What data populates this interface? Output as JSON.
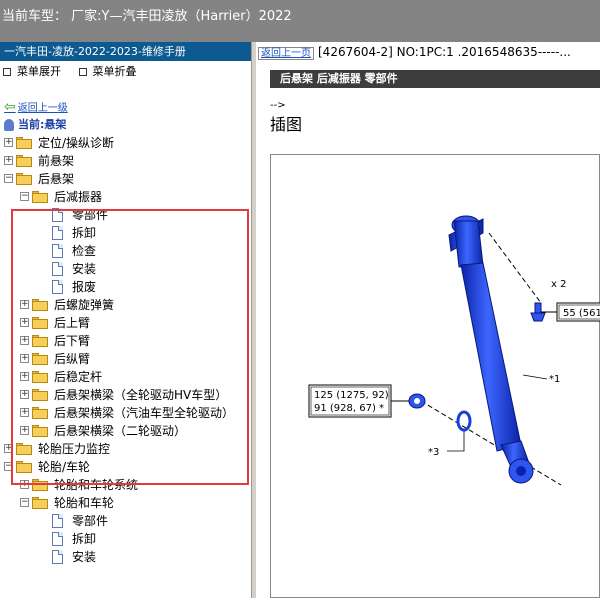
{
  "title_bar": {
    "text": "当前车型：  厂家:Y—汽丰田凌放（Harrier）2022"
  },
  "left_pane": {
    "manual_title": "一汽丰田-凌放-2022-2023-维修手册",
    "toolbar": {
      "expand_label": "菜单展开",
      "collapse_label": "菜单折叠"
    },
    "back_link": "返回上一级",
    "current_label": "当前:悬架"
  },
  "tree": [
    {
      "label": "定位/操纵诊断",
      "level": 1,
      "type": "folder",
      "toggle": "+"
    },
    {
      "label": "前悬架",
      "level": 1,
      "type": "folder",
      "toggle": "+"
    },
    {
      "label": "后悬架",
      "level": 1,
      "type": "folder",
      "toggle": "-"
    },
    {
      "label": "后减振器",
      "level": 2,
      "type": "folder",
      "toggle": "-"
    },
    {
      "label": "零部件",
      "level": 3,
      "type": "doc"
    },
    {
      "label": "拆卸",
      "level": 3,
      "type": "doc"
    },
    {
      "label": "检查",
      "level": 3,
      "type": "doc"
    },
    {
      "label": "安装",
      "level": 3,
      "type": "doc"
    },
    {
      "label": "报废",
      "level": 3,
      "type": "doc"
    },
    {
      "label": "后螺旋弹簧",
      "level": 2,
      "type": "folder",
      "toggle": "+"
    },
    {
      "label": "后上臂",
      "level": 2,
      "type": "folder",
      "toggle": "+"
    },
    {
      "label": "后下臂",
      "level": 2,
      "type": "folder",
      "toggle": "+"
    },
    {
      "label": "后纵臂",
      "level": 2,
      "type": "folder",
      "toggle": "+"
    },
    {
      "label": "后稳定杆",
      "level": 2,
      "type": "folder",
      "toggle": "+"
    },
    {
      "label": "后悬架横梁（全轮驱动HV车型）",
      "level": 2,
      "type": "folder",
      "toggle": "+"
    },
    {
      "label": "后悬架横梁（汽油车型全轮驱动）",
      "level": 2,
      "type": "folder",
      "toggle": "+"
    },
    {
      "label": "后悬架横梁（二轮驱动）",
      "level": 2,
      "type": "folder",
      "toggle": "+"
    },
    {
      "label": "轮胎压力监控",
      "level": 1,
      "type": "folder",
      "toggle": "+"
    },
    {
      "label": "轮胎/车轮",
      "level": 1,
      "type": "folder",
      "toggle": "-"
    },
    {
      "label": "轮胎和车轮系统",
      "level": 2,
      "type": "folder",
      "toggle": "+"
    },
    {
      "label": "轮胎和车轮",
      "level": 2,
      "type": "folder",
      "toggle": "-"
    },
    {
      "label": "零部件",
      "level": 3,
      "type": "doc"
    },
    {
      "label": "拆卸",
      "level": 3,
      "type": "doc"
    },
    {
      "label": "安装",
      "level": 3,
      "type": "doc"
    }
  ],
  "right_pane": {
    "back_button": "返回上一页",
    "doc_id": "[4267604-2] NO:1PC:1 .2016548635-----...",
    "section_bar": "后悬架  后减振器  零部件",
    "comment_arrow": "-->",
    "section_title": "插图"
  },
  "figure": {
    "callout_x2": "x 2",
    "callout_55": "55 (561",
    "callout_125": "125 (1275, 92)",
    "callout_91": "91 (928, 67) *",
    "label_1": "*1",
    "label_3": "*3"
  },
  "colors": {
    "part_blue": "#1a3fd8",
    "highlight": "#e03c3c",
    "title_bar": "#848484",
    "manual_title": "#0c5a90"
  }
}
